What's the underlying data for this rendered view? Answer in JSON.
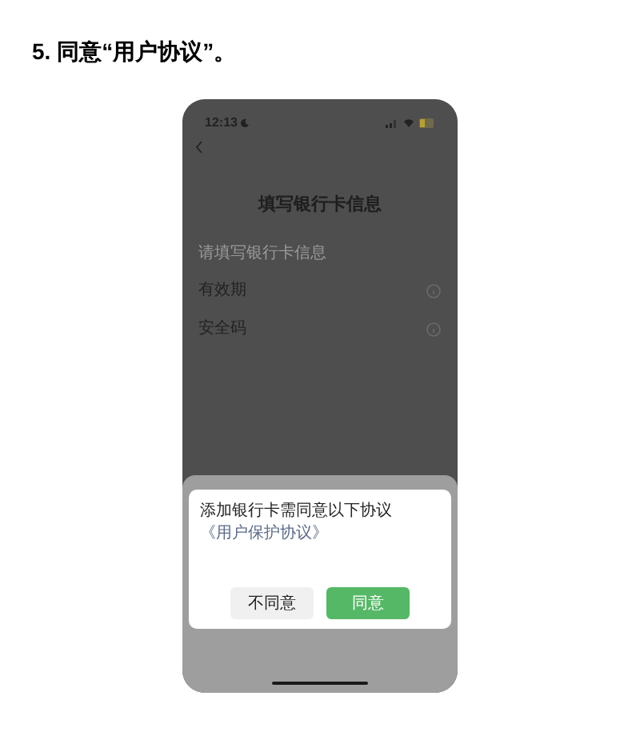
{
  "step_title": "5. 同意“用户协议”。",
  "phone": {
    "status_bar": {
      "time": "12:13"
    },
    "page_title": "填写银行卡信息",
    "hint": "请填写银行卡信息",
    "fields": [
      {
        "label": "有效期"
      },
      {
        "label": "安全码"
      }
    ],
    "dialog": {
      "message": "添加银行卡需同意以下协议",
      "link": "《用户保护协议》",
      "buttons": [
        {
          "label": "不同意",
          "kind": "secondary"
        },
        {
          "label": "同意",
          "kind": "primary"
        }
      ]
    }
  }
}
